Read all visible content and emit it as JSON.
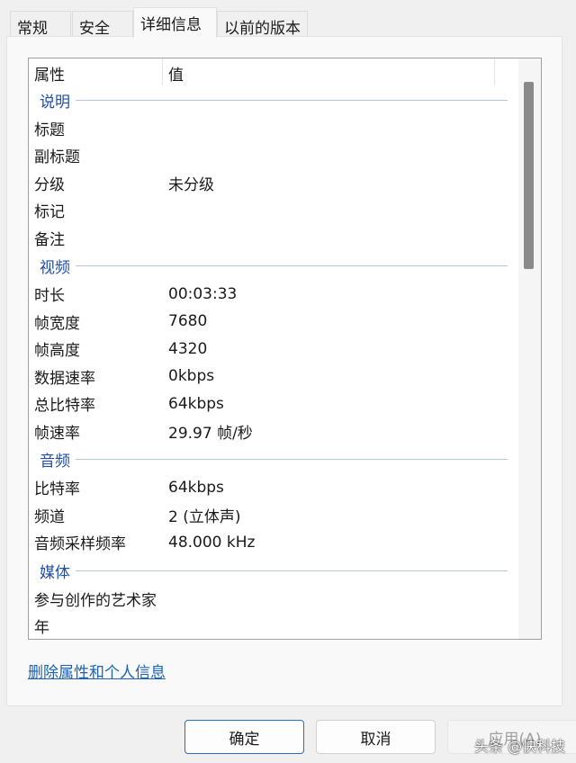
{
  "tabs": [
    "常规",
    "安全",
    "详细信息",
    "以前的版本"
  ],
  "header": {
    "property": "属性",
    "value": "值"
  },
  "groups": [
    {
      "title": "说明",
      "rows": [
        [
          "标题",
          ""
        ],
        [
          "副标题",
          ""
        ],
        [
          "分级",
          "未分级"
        ],
        [
          "标记",
          ""
        ],
        [
          "备注",
          ""
        ]
      ]
    },
    {
      "title": "视频",
      "rows": [
        [
          "时长",
          "00:03:33"
        ],
        [
          "帧宽度",
          "7680"
        ],
        [
          "帧高度",
          "4320"
        ],
        [
          "数据速率",
          "0kbps"
        ],
        [
          "总比特率",
          "64kbps"
        ],
        [
          "帧速率",
          "29.97 帧/秒"
        ]
      ]
    },
    {
      "title": "音频",
      "rows": [
        [
          "比特率",
          "64kbps"
        ],
        [
          "频道",
          "2 (立体声)"
        ],
        [
          "音频采样频率",
          "48.000 kHz"
        ]
      ]
    },
    {
      "title": "媒体",
      "rows": [
        [
          "参与创作的艺术家",
          ""
        ],
        [
          "年",
          ""
        ]
      ]
    }
  ],
  "remove_link": "删除属性和个人信息",
  "buttons": {
    "ok": "确定",
    "cancel": "取消",
    "apply": "应用(A)"
  },
  "watermark": "头条 @快科技"
}
